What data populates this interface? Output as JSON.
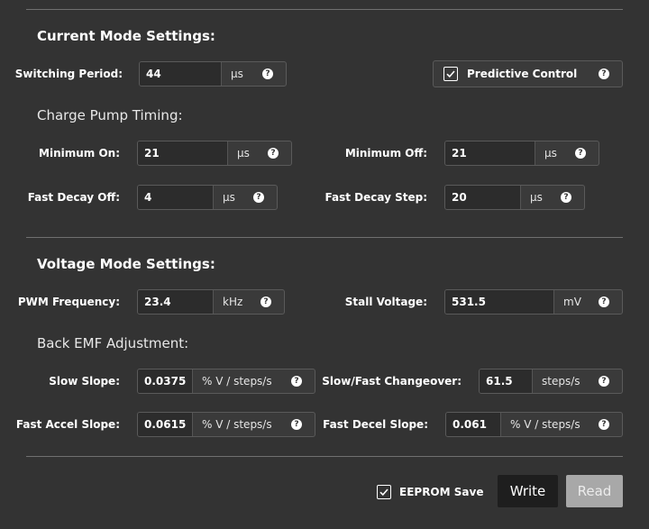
{
  "current_mode": {
    "title": "Current Mode Settings:",
    "switching_period": {
      "label": "Switching Period:",
      "value": "44",
      "unit": "µs"
    },
    "predictive_control": {
      "label": "Predictive Control",
      "checked": true
    },
    "charge_pump": {
      "title": "Charge Pump Timing:",
      "minimum_on": {
        "label": "Minimum On:",
        "value": "21",
        "unit": "µs"
      },
      "minimum_off": {
        "label": "Minimum Off:",
        "value": "21",
        "unit": "µs"
      },
      "fast_decay_off": {
        "label": "Fast Decay Off:",
        "value": "4",
        "unit": "µs"
      },
      "fast_decay_step": {
        "label": "Fast Decay Step:",
        "value": "20",
        "unit": "µs"
      }
    }
  },
  "voltage_mode": {
    "title": "Voltage Mode Settings:",
    "pwm_frequency": {
      "label": "PWM Frequency:",
      "value": "23.4",
      "unit": "kHz"
    },
    "stall_voltage": {
      "label": "Stall Voltage:",
      "value": "531.5",
      "unit": "mV"
    },
    "back_emf": {
      "title": "Back EMF Adjustment:",
      "slow_slope": {
        "label": "Slow Slope:",
        "value": "0.0375",
        "unit": "% V / steps/s"
      },
      "slow_fast_changeover": {
        "label": "Slow/Fast Changeover:",
        "value": "61.5",
        "unit": "steps/s"
      },
      "fast_accel_slope": {
        "label": "Fast Accel Slope:",
        "value": "0.0615",
        "unit": "% V / steps/s"
      },
      "fast_decel_slope": {
        "label": "Fast Decel Slope:",
        "value": "0.061",
        "unit": "% V / steps/s"
      }
    }
  },
  "footer": {
    "eeprom_save": {
      "label": "EEPROM Save",
      "checked": true
    },
    "write_label": "Write",
    "read_label": "Read"
  },
  "icons": {
    "help": "help-circle-icon",
    "check": "check-icon"
  },
  "colors": {
    "background": "#333333",
    "write_button": "#1e1e1e",
    "read_button": "#a8a8a8"
  }
}
